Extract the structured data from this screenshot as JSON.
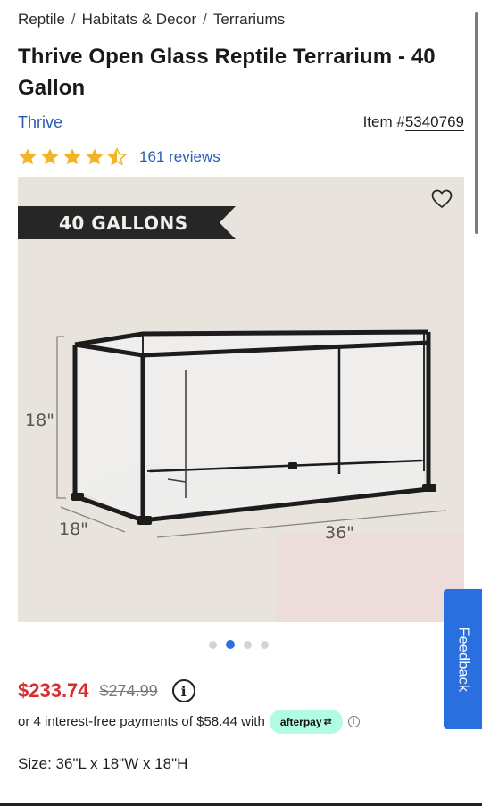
{
  "breadcrumb": {
    "items": [
      "Reptile",
      "Habitats & Decor",
      "Terrariums"
    ],
    "separator": "/"
  },
  "product": {
    "title": "Thrive Open Glass Reptile Terrarium - 40 Gallon",
    "brand": "Thrive",
    "item_label": "Item #",
    "item_number": "5340769",
    "rating": 4.5,
    "reviews_label": "161 reviews"
  },
  "gallery": {
    "banner": "40 GALLONS",
    "dims": {
      "height": "18\"",
      "depth": "18\"",
      "width": "36\""
    },
    "slide_count": 4,
    "active_slide": 2,
    "favorite_icon": "heart-outline-icon"
  },
  "pricing": {
    "price": "$233.74",
    "old_price": "$274.99",
    "info_icon": "info-icon",
    "afterpay_text": "or 4 interest-free payments of $58.44 with",
    "afterpay_badge": "afterpay",
    "afterpay_symbol": "⇄"
  },
  "size": {
    "label": "Size:",
    "value": "36\"L x 18\"W x 18\"H"
  },
  "feedback": {
    "label": "Feedback"
  },
  "colors": {
    "accent": "#2a5bb8",
    "star": "#f4b324",
    "price": "#d62d2d",
    "feedback": "#2a6fe0",
    "afterpay": "#b2fce4"
  }
}
